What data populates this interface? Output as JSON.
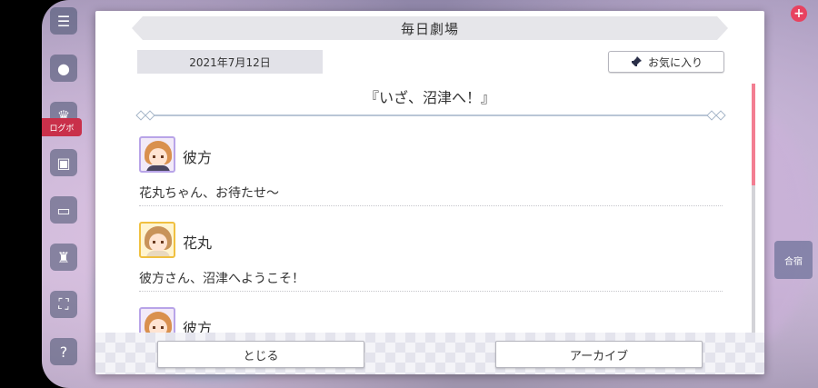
{
  "dialog": {
    "title": "毎日劇場",
    "date": "2021年7月12日",
    "favorite_label": "お気に入り",
    "story_title": "『いざ、沼津へ！』",
    "entries": [
      {
        "speaker": "彼方",
        "line": "花丸ちゃん、お待たせ〜",
        "avatar_color": "#b8a4e8"
      },
      {
        "speaker": "花丸",
        "line": "彼方さん、沼津へようこそ！",
        "avatar_color": "#f0c040"
      },
      {
        "speaker": "彼方",
        "line": "",
        "avatar_color": "#b8a4e8"
      }
    ],
    "close_label": "とじる",
    "archive_label": "アーカイブ"
  },
  "colors": {
    "scrollbar_thumb": "#f37e92",
    "accent_red": "#e84260"
  },
  "background": {
    "tag_label": "ログボ",
    "right_card_label": "合宿",
    "plus_icon": "plus-icon"
  }
}
